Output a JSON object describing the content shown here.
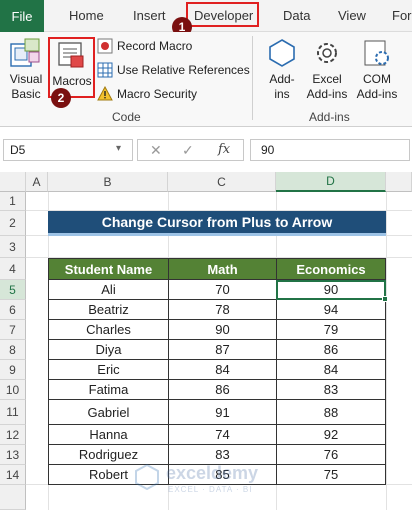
{
  "tabs": [
    "File",
    "Home",
    "Insert",
    "Developer",
    "Data",
    "View",
    "For"
  ],
  "badges": {
    "one": "1",
    "two": "2"
  },
  "ribbon": {
    "visual_basic": [
      "Visual",
      "Basic"
    ],
    "macros": "Macros",
    "record_macro": "Record Macro",
    "use_relative": "Use Relative References",
    "macro_security": "Macro Security",
    "code_group": "Code",
    "addins": [
      "Add-",
      "ins"
    ],
    "excel_addins": [
      "Excel",
      "Add-ins"
    ],
    "com_addins": [
      "COM",
      "Add-ins"
    ],
    "addins_group": "Add-ins"
  },
  "formula_bar": {
    "name_box": "D5",
    "fx": "fx",
    "value": "90"
  },
  "columns": [
    "A",
    "B",
    "C",
    "D"
  ],
  "rows": [
    "1",
    "2",
    "3",
    "4",
    "5",
    "6",
    "7",
    "8",
    "9",
    "10",
    "11",
    "12",
    "13",
    "14"
  ],
  "sheet": {
    "title": "Change Cursor from Plus to Arrow",
    "headers": [
      "Student Name",
      "Math",
      "Economics"
    ],
    "data": [
      [
        "Ali",
        "70",
        "90"
      ],
      [
        "Beatriz",
        "78",
        "94"
      ],
      [
        "Charles",
        "90",
        "79"
      ],
      [
        "Diya",
        "87",
        "86"
      ],
      [
        "Eric",
        "84",
        "84"
      ],
      [
        "Fatima",
        "86",
        "83"
      ],
      [
        "Gabriel",
        "91",
        "88"
      ],
      [
        "Hanna",
        "74",
        "92"
      ],
      [
        "Rodriguez",
        "83",
        "76"
      ],
      [
        "Robert",
        "85",
        "75"
      ]
    ]
  },
  "watermark": {
    "name": "exceldemy",
    "tagline": "EXCEL · DATA · BI"
  },
  "colors": {
    "excel_green": "#217346",
    "title_blue": "#1f4e79",
    "header_green": "#548235",
    "highlight_red": "#e02020"
  }
}
